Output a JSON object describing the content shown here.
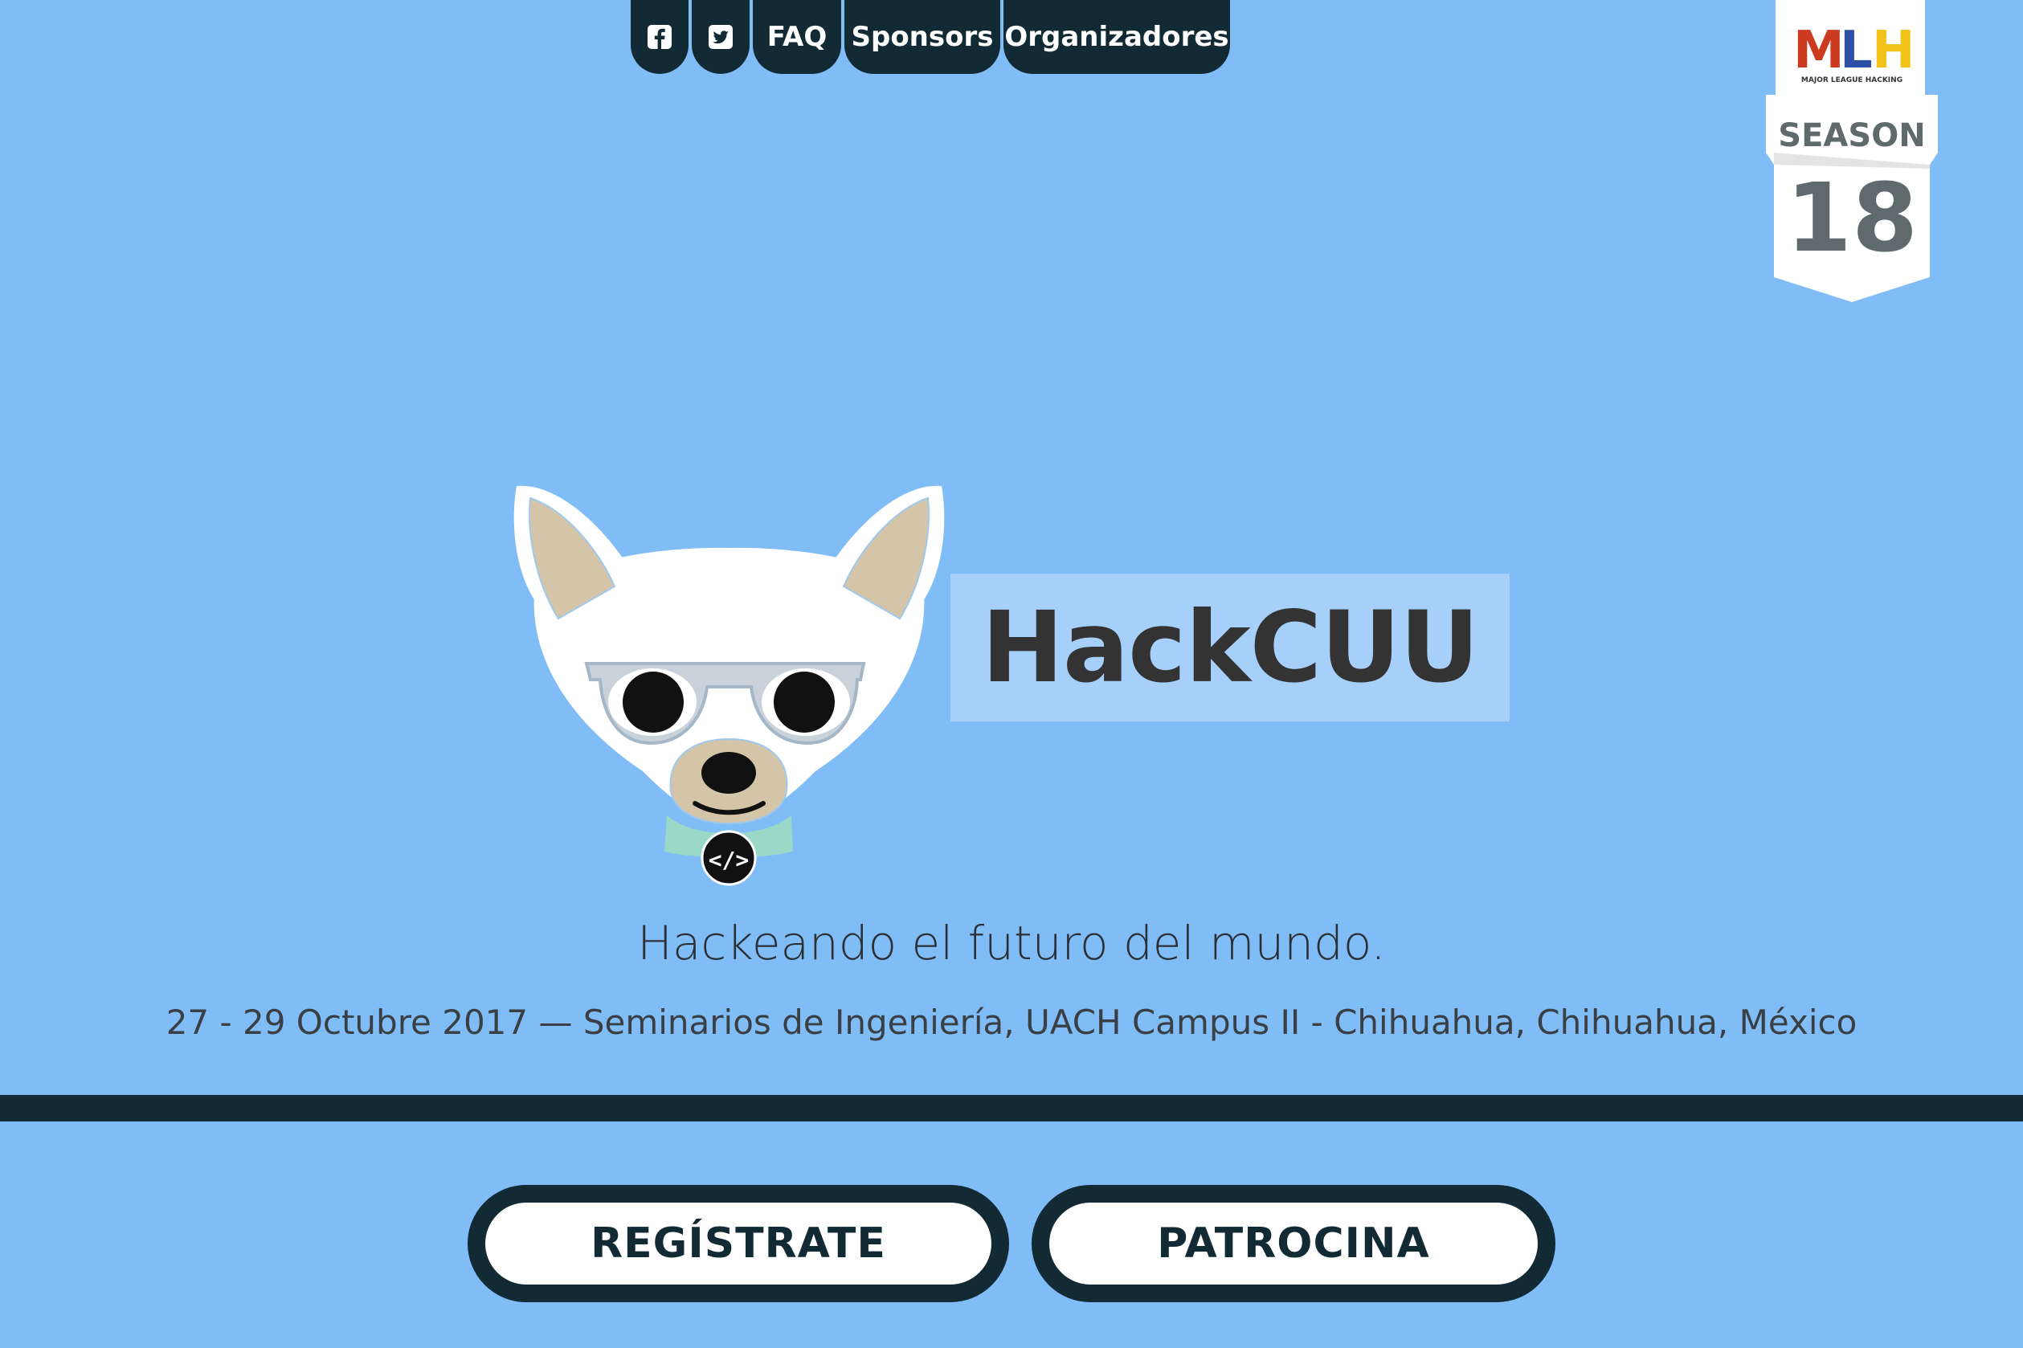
{
  "nav": {
    "facebook_icon": "facebook-icon",
    "twitter_icon": "twitter-icon",
    "faq": "FAQ",
    "sponsors": "Sponsors",
    "organizers": "Organizadores"
  },
  "mlh_badge": {
    "logo": "MLH",
    "sublabel": "MAJOR LEAGUE HACKING",
    "season_label": "SEASON",
    "season_number": "18"
  },
  "hero": {
    "title": "HackCUU",
    "tagline": "Hackeando el futuro del mundo.",
    "details": "27 - 29 Octubre 2017 — Seminarios de Ingeniería, UACH Campus II - Chihuahua, Chihuahua, México"
  },
  "actions": {
    "register": "REGÍSTRATE",
    "sponsor": "PATROCINA"
  },
  "colors": {
    "background": "#80bdf7",
    "dark": "#112a33",
    "title_box": "#a6d0f9",
    "white": "#ffffff"
  }
}
